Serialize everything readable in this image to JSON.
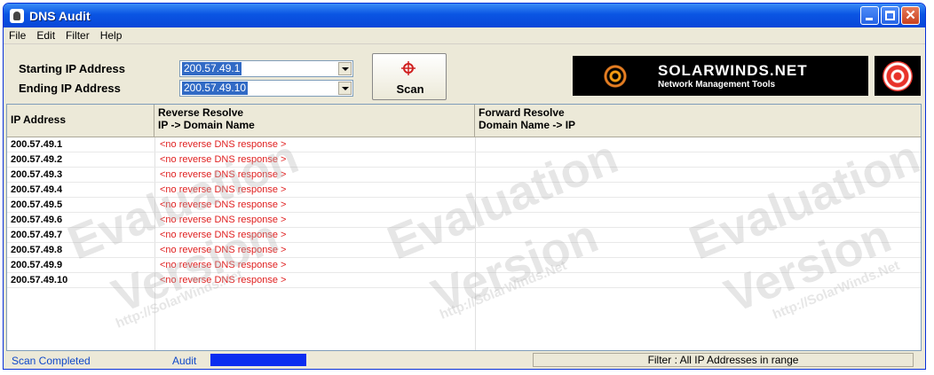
{
  "window": {
    "title": "DNS Audit"
  },
  "menu": [
    "File",
    "Edit",
    "Filter",
    "Help"
  ],
  "form": {
    "start_label": "Starting IP Address",
    "start_value": "200.57.49.1",
    "end_label": "Ending IP Address",
    "end_value": "200.57.49.10",
    "scan_label": "Scan"
  },
  "logo": {
    "brand": "SOLARWINDS.NET",
    "tagline": "Network Management Tools"
  },
  "table": {
    "headers": {
      "ip": "IP Address",
      "rev_line1": "Reverse Resolve",
      "rev_line2": "IP -> Domain Name",
      "fwd_line1": "Forward Resolve",
      "fwd_line2": "Domain Name -> IP"
    },
    "rows": [
      {
        "ip": "200.57.49.1",
        "reverse": "<no reverse DNS response >",
        "forward": ""
      },
      {
        "ip": "200.57.49.2",
        "reverse": "<no reverse DNS response >",
        "forward": ""
      },
      {
        "ip": "200.57.49.3",
        "reverse": "<no reverse DNS response >",
        "forward": ""
      },
      {
        "ip": "200.57.49.4",
        "reverse": "<no reverse DNS response >",
        "forward": ""
      },
      {
        "ip": "200.57.49.5",
        "reverse": "<no reverse DNS response >",
        "forward": ""
      },
      {
        "ip": "200.57.49.6",
        "reverse": "<no reverse DNS response >",
        "forward": ""
      },
      {
        "ip": "200.57.49.7",
        "reverse": "<no reverse DNS response >",
        "forward": ""
      },
      {
        "ip": "200.57.49.8",
        "reverse": "<no reverse DNS response >",
        "forward": ""
      },
      {
        "ip": "200.57.49.9",
        "reverse": "<no reverse DNS response >",
        "forward": ""
      },
      {
        "ip": "200.57.49.10",
        "reverse": "<no reverse DNS response >",
        "forward": ""
      }
    ]
  },
  "watermark": {
    "line1": "Evaluation",
    "line2": "Version",
    "url": "http://SolarWinds.Net"
  },
  "status": {
    "state": "Scan Completed",
    "audit_label": "Audit",
    "audit_progress": 1.0,
    "filter": "Filter : All IP Addresses in range"
  },
  "colors": {
    "titlebar": "#0a55e3",
    "selection": "#316ac5",
    "error_text": "#e02020",
    "status_text": "#1048c8"
  }
}
